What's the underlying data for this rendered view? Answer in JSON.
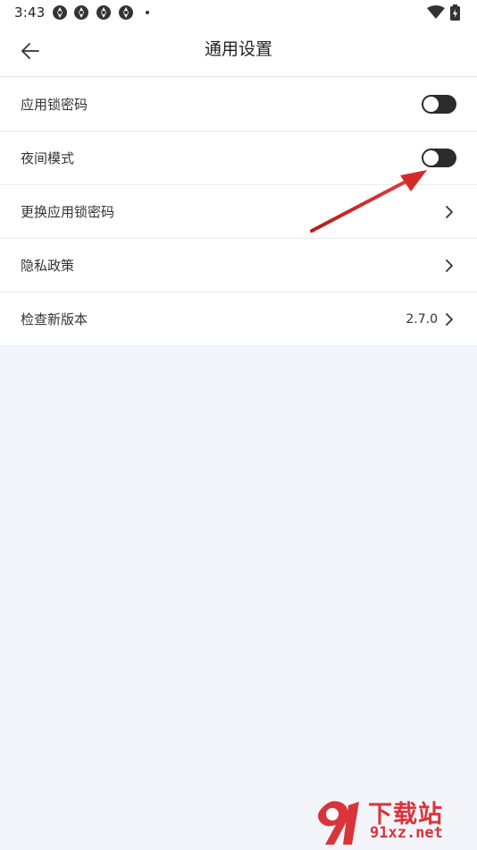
{
  "status_bar": {
    "time": "3:43"
  },
  "header": {
    "title": "通用设置"
  },
  "settings": {
    "items": [
      {
        "label": "应用锁密码",
        "control": "toggle",
        "on": false
      },
      {
        "label": "夜间模式",
        "control": "toggle",
        "on": false
      },
      {
        "label": "更换应用锁密码",
        "control": "chevron"
      },
      {
        "label": "隐私政策",
        "control": "chevron"
      },
      {
        "label": "检查新版本",
        "control": "chevron",
        "value": "2.7.0"
      }
    ]
  },
  "watermark": {
    "title": "下载站",
    "url": "91xz.net"
  },
  "colors": {
    "accent_red": "#d9343a",
    "toggle_track": "#2b2b2b",
    "page_bg": "#f4f5fa"
  }
}
